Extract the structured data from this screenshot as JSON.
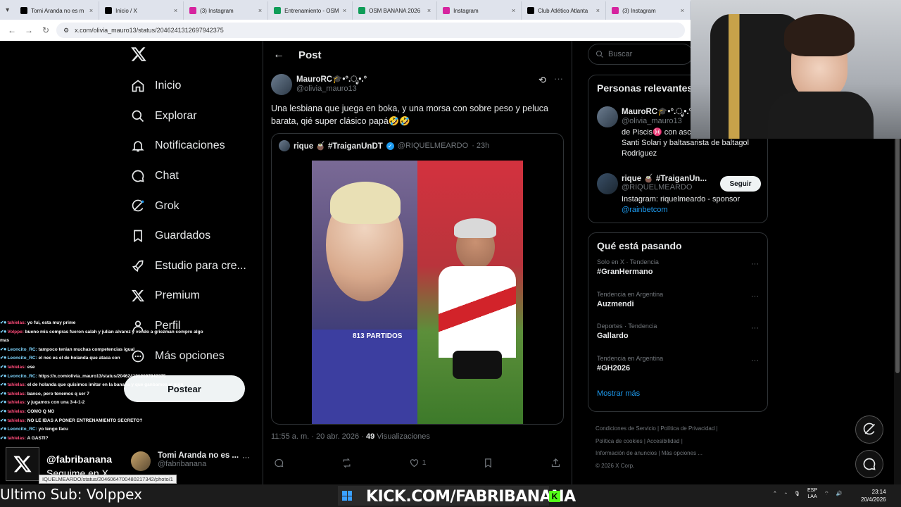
{
  "browser": {
    "tabs": [
      {
        "title": "Tomi Aranda no es m",
        "icon": "x-logo-icon",
        "active": false
      },
      {
        "title": "Inicio / X",
        "icon": "x-logo-icon",
        "active": false
      },
      {
        "title": "(3) Instagram",
        "icon": "instagram-icon",
        "active": false
      },
      {
        "title": "Entrenamiento - OSM",
        "icon": "sheet-icon",
        "active": false
      },
      {
        "title": "OSM BANANA 2026",
        "icon": "sheet-icon",
        "active": false
      },
      {
        "title": "Instagram",
        "icon": "instagram-icon",
        "active": false
      },
      {
        "title": "Club Atlético Atlanta",
        "icon": "x-logo-icon",
        "active": false
      },
      {
        "title": "(3) Instagram",
        "icon": "instagram-icon",
        "active": false
      }
    ],
    "url": "x.com/olivia_mauro13/status/2046241312697942375"
  },
  "nav": {
    "items": [
      "Inicio",
      "Explorar",
      "Notificaciones",
      "Chat",
      "Grok",
      "Guardados",
      "Estudio para cre...",
      "Premium",
      "Perfil",
      "Más opciones"
    ],
    "post_button": "Postear"
  },
  "header": {
    "title": "Post"
  },
  "post": {
    "author_name": "MauroRC🎓•°.ೃ•.°",
    "author_handle": "@olivia_mauro13",
    "text": "Una lesbiana que juega en boka, y una morsa con sobre peso y peluca barata, qié super clásico papá🤣🤣",
    "quote": {
      "name": "rique 🧉 #TraiganUnDT",
      "handle": "@RIQUELMEARDO",
      "time": "· 23h",
      "media_caption": "813 PARTIDOS"
    },
    "timestamp": "11:55 a. m. · 20 abr. 2026 ·",
    "views_count": "49",
    "views_label": "Visualizaciones",
    "likes": "1"
  },
  "sidebar": {
    "search_placeholder": "Buscar",
    "relevant_title": "Personas relevantes",
    "people": [
      {
        "name": "MauroRC🎓•°.ೃ•.°",
        "handle": "@olivia_mauro13",
        "bio": "de Piscis♓ con ascen... 🎓 Solarista de Santi Solari y baltasarista de baltagol Rodriguez"
      },
      {
        "name": "rique 🧉 #TraiganUn...",
        "handle": "@RIQUELMEARDO",
        "bio": "Instagram: riquelmeardo - sponsor",
        "link": "@rainbetcom",
        "follow": "Seguir"
      }
    ],
    "trends_title": "Qué está pasando",
    "trends": [
      {
        "meta": "Solo en X · Tendencia",
        "name": "#GranHermano"
      },
      {
        "meta": "Tendencia en Argentina",
        "name": "Auzmendi"
      },
      {
        "meta": "Deportes · Tendencia",
        "name": "Gallardo"
      },
      {
        "meta": "Tendencia en Argentina",
        "name": "#GH2026"
      }
    ],
    "show_more": "Mostrar más",
    "footer": [
      "Condiciones de Servicio",
      "Política de Privacidad",
      "Política de cookies",
      "Accesibilidad",
      "Información de anuncios",
      "Más opciones ...",
      "© 2026 X Corp."
    ]
  },
  "account": {
    "name": "Tomi Aranda no es ...",
    "handle": "@fabribanana"
  },
  "chat": [
    {
      "user": "tahielas:",
      "msg": "yo fui, esta muy prime",
      "c": "cn"
    },
    {
      "user": "Volppe:",
      "msg": "bueno mis compras fueron salah y julian alvarez y vendo a griezman compro algo mas",
      "c": "cn"
    },
    {
      "user": "Leoncito_RC:",
      "msg": "tampoco tenian muchas competencias igual",
      "c": "cg"
    },
    {
      "user": "Leoncito_RC:",
      "msg": "el nec es el de holanda que ataca con",
      "c": "cg"
    },
    {
      "user": "tahielas:",
      "msg": "ese",
      "c": "cn"
    },
    {
      "user": "Leoncito_RC:",
      "msg": "https://x.com/olivia_mauro13/status/2046241312697942375",
      "c": "cg"
    },
    {
      "user": "tahielas:",
      "msg": "el de holanda que quisimos imitar en la banana y que ganbamos al quin",
      "c": "cn"
    },
    {
      "user": "tahielas:",
      "msg": "banco, pero tenemos q ser 7",
      "c": "cn"
    },
    {
      "user": "tahielas:",
      "msg": "y jugamos con una 3-4-1-2",
      "c": "cn"
    },
    {
      "user": "tahielas:",
      "msg": "COMO Q NO",
      "c": "cn"
    },
    {
      "user": "tahielas:",
      "msg": "NO LE IBAS A PONER ENTRENAMIENTO SECRETO?",
      "c": "cn"
    },
    {
      "user": "Leoncito_RC:",
      "msg": "yo tengo facu",
      "c": "cg"
    },
    {
      "user": "tahielas:",
      "msg": "A GASTI?",
      "c": "cn"
    }
  ],
  "overlay": {
    "x_handle": "@fabribanana",
    "x_sub": "Seguime en X",
    "status_url": "IQUELMEARDO/status/2046064700480217342/photo/1",
    "last_sub": "Ultimo Sub: Volppex",
    "kick": "KICK.COM/FABRIBANANA"
  },
  "system": {
    "lang1": "ESP",
    "lang2": "LAA",
    "time": "23:14",
    "date": "20/4/2026"
  }
}
